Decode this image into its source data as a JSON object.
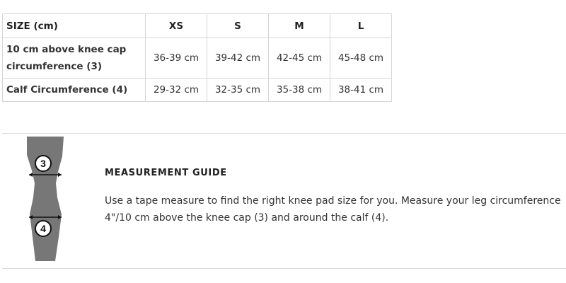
{
  "size_table": {
    "header": [
      "SIZE (cm)",
      "XS",
      "S",
      "M",
      "L"
    ],
    "rows": [
      {
        "label_line1": "10 cm above knee cap",
        "label_line2": "circumference (3)",
        "values": [
          "36-39 cm",
          "39-42 cm",
          "42-45 cm",
          "45-48 cm"
        ]
      },
      {
        "label": "Calf Circumference (4)",
        "values": [
          "29-32 cm",
          "32-35 cm",
          "35-38 cm",
          "38-41 cm"
        ]
      }
    ]
  },
  "guide": {
    "title": "MEASUREMENT GUIDE",
    "text": "Use a tape measure to find the right knee pad size for you. Measure your leg circumference 4\"/10 cm above the knee cap (3) and around the calf (4).",
    "marker_top": "3",
    "marker_bottom": "4"
  },
  "colors": {
    "leg_fill": "#777777",
    "border": "#d6d6d6",
    "divider": "#dcdcdc"
  }
}
